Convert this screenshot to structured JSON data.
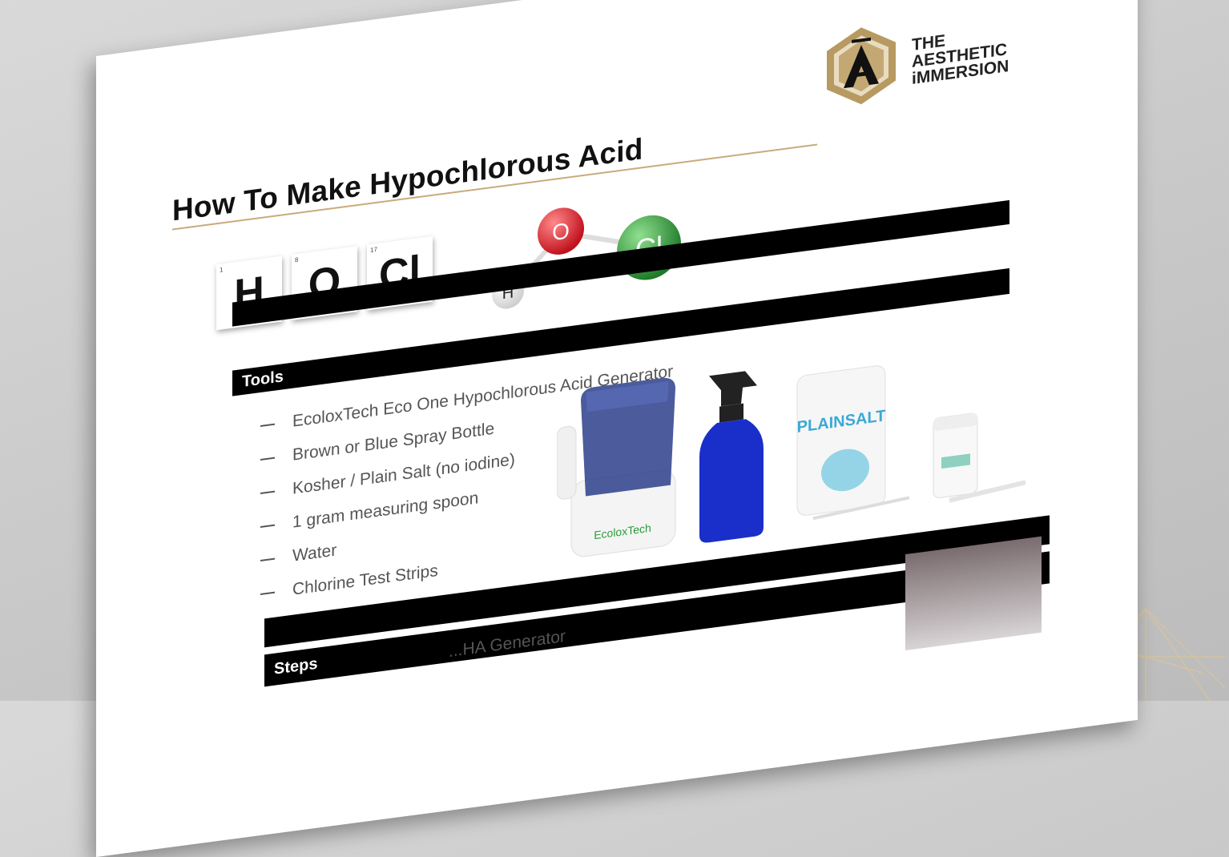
{
  "document": {
    "title": "How To Make Hypochlorous Acid",
    "brand": {
      "line1": "THE",
      "line2": "AESTHETIC",
      "line3": "iMMERSION",
      "logo_letter": "A",
      "color_gold": "#b79a62"
    },
    "element_tiles": [
      {
        "number": "1",
        "symbol": "H"
      },
      {
        "number": "8",
        "symbol": "O"
      },
      {
        "number": "17",
        "symbol": "Cl"
      }
    ],
    "molecule": {
      "atoms": [
        {
          "symbol": "H",
          "color": "#f2f2f2"
        },
        {
          "symbol": "O",
          "color": "#d8202c"
        },
        {
          "symbol": "Cl",
          "color": "#2e9a3a"
        }
      ]
    },
    "tools_section": {
      "heading": "Tools",
      "items": [
        "EcoloxTech Eco One Hypochlorous Acid Generator",
        "Brown or Blue Spray Bottle",
        "Kosher / Plain Salt (no iodine)",
        "1 gram measuring spoon",
        "Water",
        "Chlorine Test Strips"
      ]
    },
    "products": {
      "generator_label": "EcoloxTech",
      "salt_label": "PLAINSALT"
    },
    "steps_section": {
      "heading": "Steps",
      "first_step_partial": "...HA Generator"
    }
  }
}
